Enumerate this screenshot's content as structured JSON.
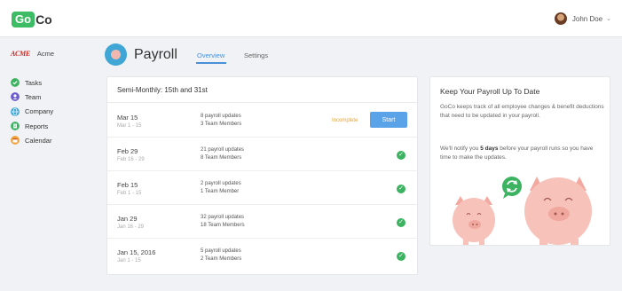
{
  "app": {
    "logo_go": "Go",
    "logo_co": "Co"
  },
  "user": {
    "name": "John Doe",
    "caret": "⌄"
  },
  "sidebar": {
    "company_logo": "ACME",
    "company_name": "Acme",
    "items": [
      {
        "label": "Tasks",
        "icon": "check-circle-icon",
        "color": "#3bb361"
      },
      {
        "label": "Team",
        "icon": "team-icon",
        "color": "#6a5acd"
      },
      {
        "label": "Company",
        "icon": "globe-icon",
        "color": "#3fa6d6"
      },
      {
        "label": "Reports",
        "icon": "reports-icon",
        "color": "#3bb361"
      },
      {
        "label": "Calendar",
        "icon": "calendar-icon",
        "color": "#f0a23a"
      }
    ]
  },
  "header": {
    "title": "Payroll",
    "tabs": [
      {
        "label": "Overview"
      },
      {
        "label": "Settings"
      }
    ]
  },
  "schedule": {
    "title": "Semi-Monthly: 15th and 31st",
    "rows": [
      {
        "date": "Mar 15",
        "period": "Mar 1 - 15",
        "updates": "8 payroll updates",
        "members": "3 Team Members",
        "status": "Incomplete",
        "action": "Start"
      },
      {
        "date": "Feb 29",
        "period": "Feb 16 - 29",
        "updates": "21 payroll updates",
        "members": "8 Team Members",
        "status": "complete"
      },
      {
        "date": "Feb 15",
        "period": "Feb 1 - 15",
        "updates": "2 payroll updates",
        "members": "1 Team Member",
        "status": "complete"
      },
      {
        "date": "Jan 29",
        "period": "Jan 16 - 29",
        "updates": "32 payroll updates",
        "members": "18 Team Members",
        "status": "complete"
      },
      {
        "date": "Jan 15, 2016",
        "period": "Jan 1 - 15",
        "updates": "5 payroll updates",
        "members": "2 Team Members",
        "status": "complete"
      }
    ]
  },
  "info": {
    "title": "Keep Your Payroll Up To Date",
    "p1": "GoCo keeps track of all employee changes & benefit deductions that need to be updated in your payroll.",
    "p2_a": "We'll notify you ",
    "p2_b": "5 days",
    "p2_c": " before your payroll runs so you have time to make the updates."
  },
  "colors": {
    "accent": "#4a90d9",
    "success": "#3bb361",
    "warning": "#e8a33d",
    "brand": "#3dbb65"
  }
}
